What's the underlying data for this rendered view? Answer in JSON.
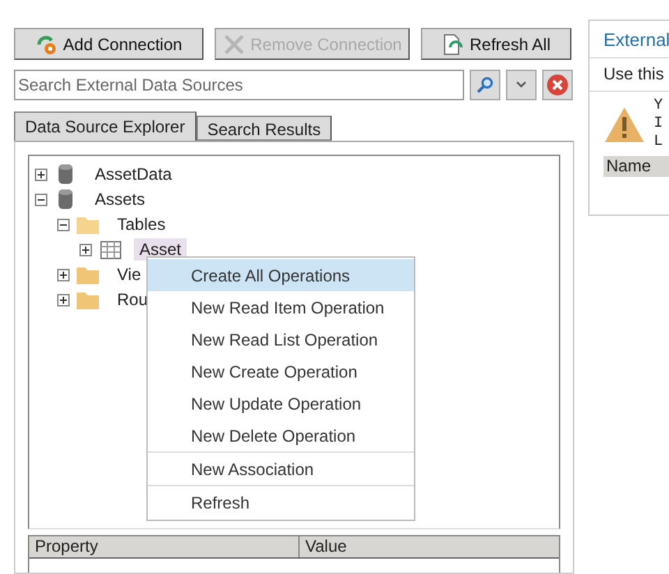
{
  "toolbar": [
    {
      "label": "Add Connection",
      "kind": "add",
      "disabled": false
    },
    {
      "label": "Remove Connection",
      "kind": "remove",
      "disabled": true
    },
    {
      "label": "Refresh All",
      "kind": "refresh",
      "disabled": false
    }
  ],
  "search": {
    "placeholder": "Search External Data Sources"
  },
  "tabs": [
    {
      "label": "Data Source Explorer",
      "selected": true
    },
    {
      "label": "Search Results",
      "selected": false
    }
  ],
  "tree": [
    {
      "label": "AssetData",
      "kind": "database",
      "expanded": false,
      "selected": false
    },
    {
      "label": "Assets",
      "kind": "database",
      "expanded": true,
      "selected": false,
      "children": [
        {
          "label": "Tables",
          "kind": "folder-open",
          "expanded": true,
          "selected": false,
          "children": [
            {
              "label": "Asset",
              "kind": "table",
              "expanded": false,
              "selected": true
            }
          ]
        },
        {
          "label": "Vie",
          "kind": "folder",
          "expanded": false,
          "selected": false
        },
        {
          "label": "Rou",
          "kind": "folder",
          "expanded": false,
          "selected": false
        }
      ]
    }
  ],
  "context_menu": [
    {
      "label": "Create All Operations",
      "selected": true,
      "separator_after": false
    },
    {
      "label": "New Read Item Operation",
      "selected": false,
      "separator_after": false
    },
    {
      "label": "New Read List Operation",
      "selected": false,
      "separator_after": false
    },
    {
      "label": "New Create Operation",
      "selected": false,
      "separator_after": false
    },
    {
      "label": "New Update Operation",
      "selected": false,
      "separator_after": false
    },
    {
      "label": "New Delete Operation",
      "selected": false,
      "separator_after": true
    },
    {
      "label": "New Association",
      "selected": false,
      "separator_after": true
    },
    {
      "label": "Refresh",
      "selected": false,
      "separator_after": false
    }
  ],
  "property_grid": {
    "columns": [
      "Property",
      "Value"
    ]
  },
  "side_panel": {
    "title": "External",
    "subtitle": "Use this",
    "message_lines": [
      "Y",
      "I",
      "L"
    ],
    "column": "Name"
  }
}
